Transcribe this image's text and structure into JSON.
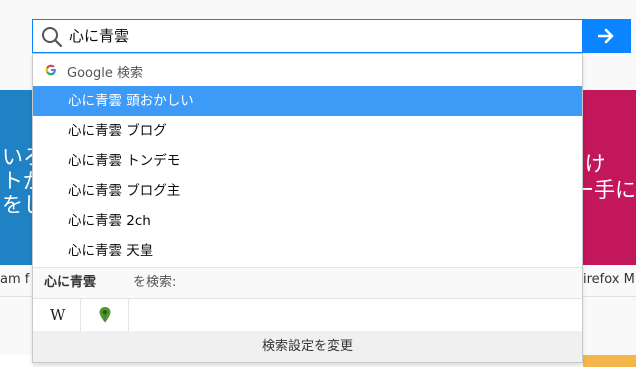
{
  "search": {
    "query": "心に青雲",
    "go_label": "→"
  },
  "dropdown": {
    "engine_label": "Google 検索",
    "suggestions": [
      {
        "query": "心に青雲",
        "rest": " 頭おかしい"
      },
      {
        "query": "心に青雲",
        "rest": " ブログ"
      },
      {
        "query": "心に青雲",
        "rest": " トンデモ"
      },
      {
        "query": "心に青雲",
        "rest": " ブログ主"
      },
      {
        "query": "心に青雲",
        "rest": " 2ch"
      },
      {
        "query": "心に青雲",
        "rest": " 天皇"
      }
    ],
    "search_with_term": "心に青雲",
    "search_with_label": "を検索:",
    "engines": [
      {
        "name": "Wikipedia",
        "glyph": "W",
        "icon": "wikipedia-icon"
      },
      {
        "name": "other-engine",
        "icon": "map-pin-icon"
      }
    ],
    "settings_label": "検索設定を変更"
  },
  "background": {
    "left_tile_lines": [
      "いろ",
      "トが",
      "をし"
    ],
    "left_caption": "am f",
    "right_tile_lines": [
      "efox 向け",
      "リー手に"
    ],
    "right_caption": "irefox M"
  },
  "colors": {
    "accent": "#0a84ff",
    "selected_row": "#3d9bf7",
    "left_tile": "#1f82c4",
    "right_tile": "#c2175b"
  }
}
